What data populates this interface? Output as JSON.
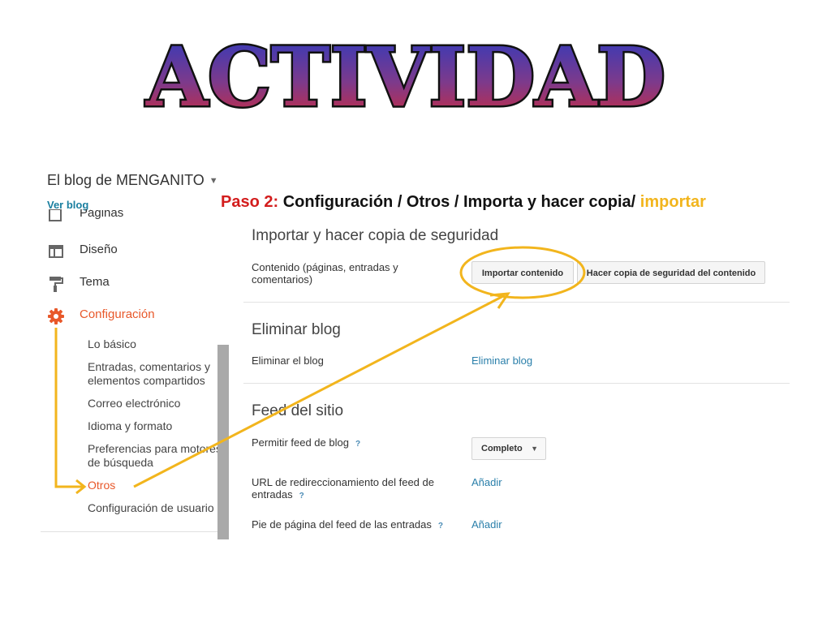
{
  "title_art": "ACTIVIDAD",
  "blog": {
    "title": "El blog de MENGANITO",
    "view_link": "Ver blog"
  },
  "sidebar": {
    "items": [
      {
        "label": "Páginas",
        "icon": "pages-icon"
      },
      {
        "label": "Diseño",
        "icon": "layout-icon"
      },
      {
        "label": "Tema",
        "icon": "paint-roller-icon"
      },
      {
        "label": "Configuración",
        "icon": "gear-icon",
        "active": true
      }
    ],
    "subitems": [
      "Lo básico",
      "Entradas, comentarios y elementos compartidos",
      "Correo electrónico",
      "Idioma y formato",
      "Preferencias para motores de búsqueda",
      "Otros",
      "Configuración de usuario"
    ],
    "active_subitem": "Otros"
  },
  "instruction": {
    "step": "Paso 2:",
    "path": " Configuración / Otros / Importa y hacer copia/ ",
    "highlight": "importar"
  },
  "import_section": {
    "title": "Importar y hacer copia de seguridad",
    "content_label": "Contenido (páginas, entradas y comentarios)",
    "import_button": "Importar contenido",
    "backup_button": "Hacer copia de seguridad del contenido"
  },
  "delete_section": {
    "title": "Eliminar blog",
    "label": "Eliminar el blog",
    "link": "Eliminar blog"
  },
  "feed_section": {
    "title": "Feed del sitio",
    "allow_feed_label": "Permitir feed de blog",
    "allow_feed_value": "Completo",
    "redirect_label": "URL de redireccionamiento del feed de entradas",
    "redirect_link": "Añadir",
    "footer_label": "Pie de página del feed de las entradas",
    "footer_link": "Añadir",
    "help": "?"
  },
  "colors": {
    "accent": "#e8582a",
    "link": "#2a7faa",
    "annotation": "#f2b51d",
    "step_red": "#d31d1d"
  }
}
